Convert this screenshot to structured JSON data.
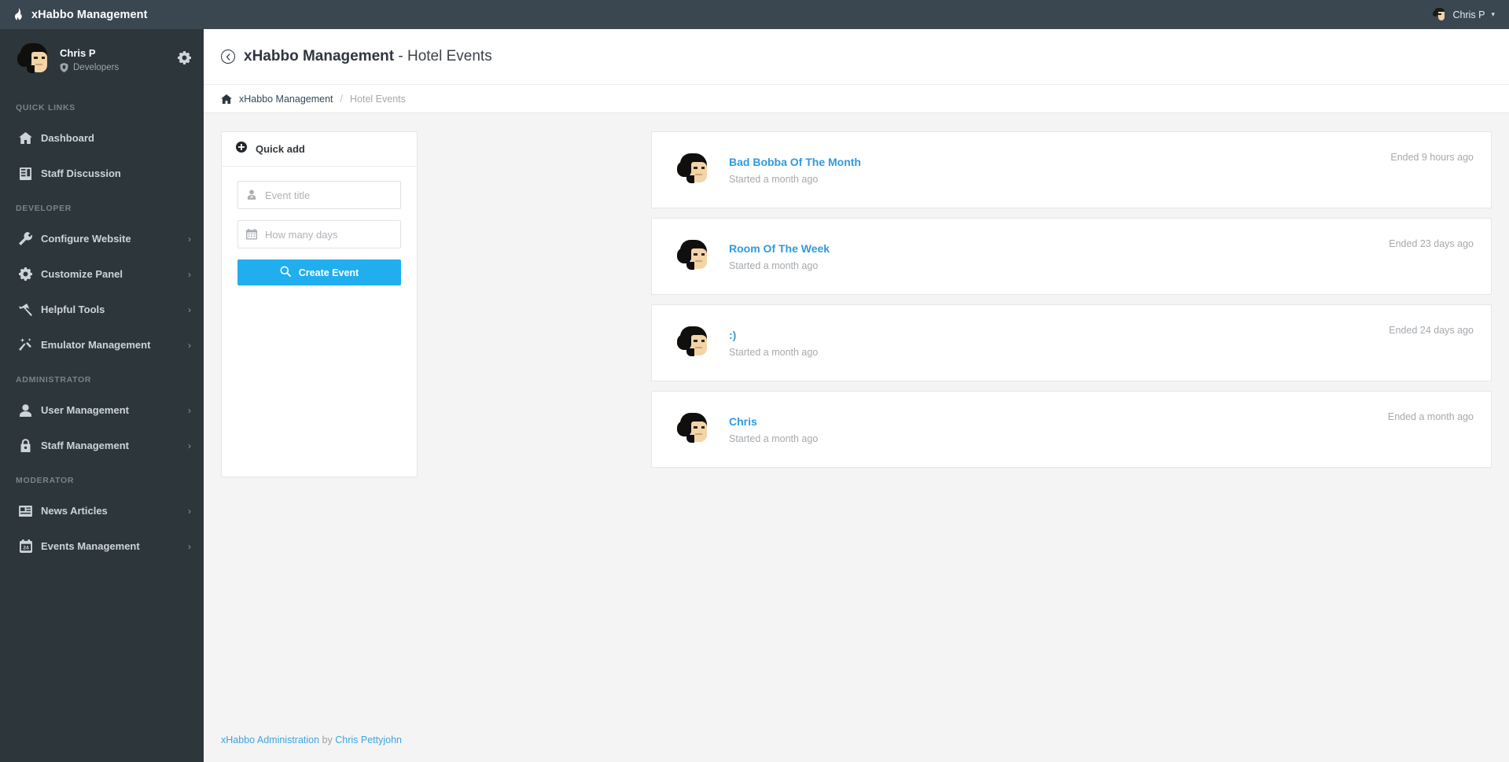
{
  "topbar": {
    "brand_title": "xHabbo Management",
    "brand_icon": "flame-icon",
    "user_name": "Chris P",
    "user_chevron": "▾"
  },
  "sidebar": {
    "user": {
      "name": "Chris P",
      "role": "Developers",
      "role_icon": "shield-icon",
      "settings_icon": "gear-icon"
    },
    "sections": [
      {
        "label": "QUICK LINKS",
        "items": [
          {
            "label": "Dashboard",
            "icon": "home-icon",
            "caret": ""
          },
          {
            "label": "Staff Discussion",
            "icon": "book-icon",
            "caret": ""
          }
        ]
      },
      {
        "label": "DEVELOPER",
        "items": [
          {
            "label": "Configure Website",
            "icon": "wrench-icon",
            "caret": "›"
          },
          {
            "label": "Customize Panel",
            "icon": "gear-icon",
            "caret": "›"
          },
          {
            "label": "Helpful Tools",
            "icon": "hammer-icon",
            "caret": "›"
          },
          {
            "label": "Emulator Management",
            "icon": "magic-wand-icon",
            "caret": "›"
          }
        ]
      },
      {
        "label": "ADMINISTRATOR",
        "items": [
          {
            "label": "User Management",
            "icon": "user-icon",
            "caret": "›"
          },
          {
            "label": "Staff Management",
            "icon": "lock-icon",
            "caret": "›"
          }
        ]
      },
      {
        "label": "MODERATOR",
        "items": [
          {
            "label": "News Articles",
            "icon": "newspaper-icon",
            "caret": "›"
          },
          {
            "label": "Events Management",
            "icon": "calendar-24-icon",
            "caret": "›"
          }
        ]
      }
    ]
  },
  "page": {
    "back_icon": "back-arrow-icon",
    "title_bold": "xHabbo Management",
    "title_rest": " - Hotel Events",
    "breadcrumb": {
      "home_icon": "home-icon",
      "root": "xHabbo Management",
      "separator": "/",
      "current": "Hotel Events"
    }
  },
  "quick_add": {
    "header_icon": "plus-circle-icon",
    "header_label": "Quick add",
    "title_field": {
      "icon": "user-add-icon",
      "placeholder": "Event title",
      "value": ""
    },
    "days_field": {
      "icon": "calendar-icon",
      "placeholder": "How many days",
      "value": ""
    },
    "submit": {
      "icon": "search-icon",
      "label": "Create Event"
    },
    "accent_color": "#20aeef"
  },
  "events": [
    {
      "avatar": "habbo-avatar",
      "title": "Bad Bobba Of The Month",
      "started": "Started a month ago",
      "ended": "Ended 9 hours ago"
    },
    {
      "avatar": "habbo-avatar",
      "title": "Room Of The Week",
      "started": "Started a month ago",
      "ended": "Ended 23 days ago"
    },
    {
      "avatar": "habbo-avatar",
      "title": ":)",
      "started": "Started a month ago",
      "ended": "Ended 24 days ago"
    },
    {
      "avatar": "habbo-avatar",
      "title": "Chris",
      "started": "Started a month ago",
      "ended": "Ended a month ago"
    }
  ],
  "footer": {
    "link_text": "xHabbo Administration",
    "by_text": " by ",
    "author_text": "Chris Pettyjohn"
  },
  "colors": {
    "topbar": "#3a4751",
    "sidebar": "#2c363b",
    "accent": "#20aeef",
    "link": "#2f9ae0",
    "page_bg": "#f4f4f4"
  }
}
